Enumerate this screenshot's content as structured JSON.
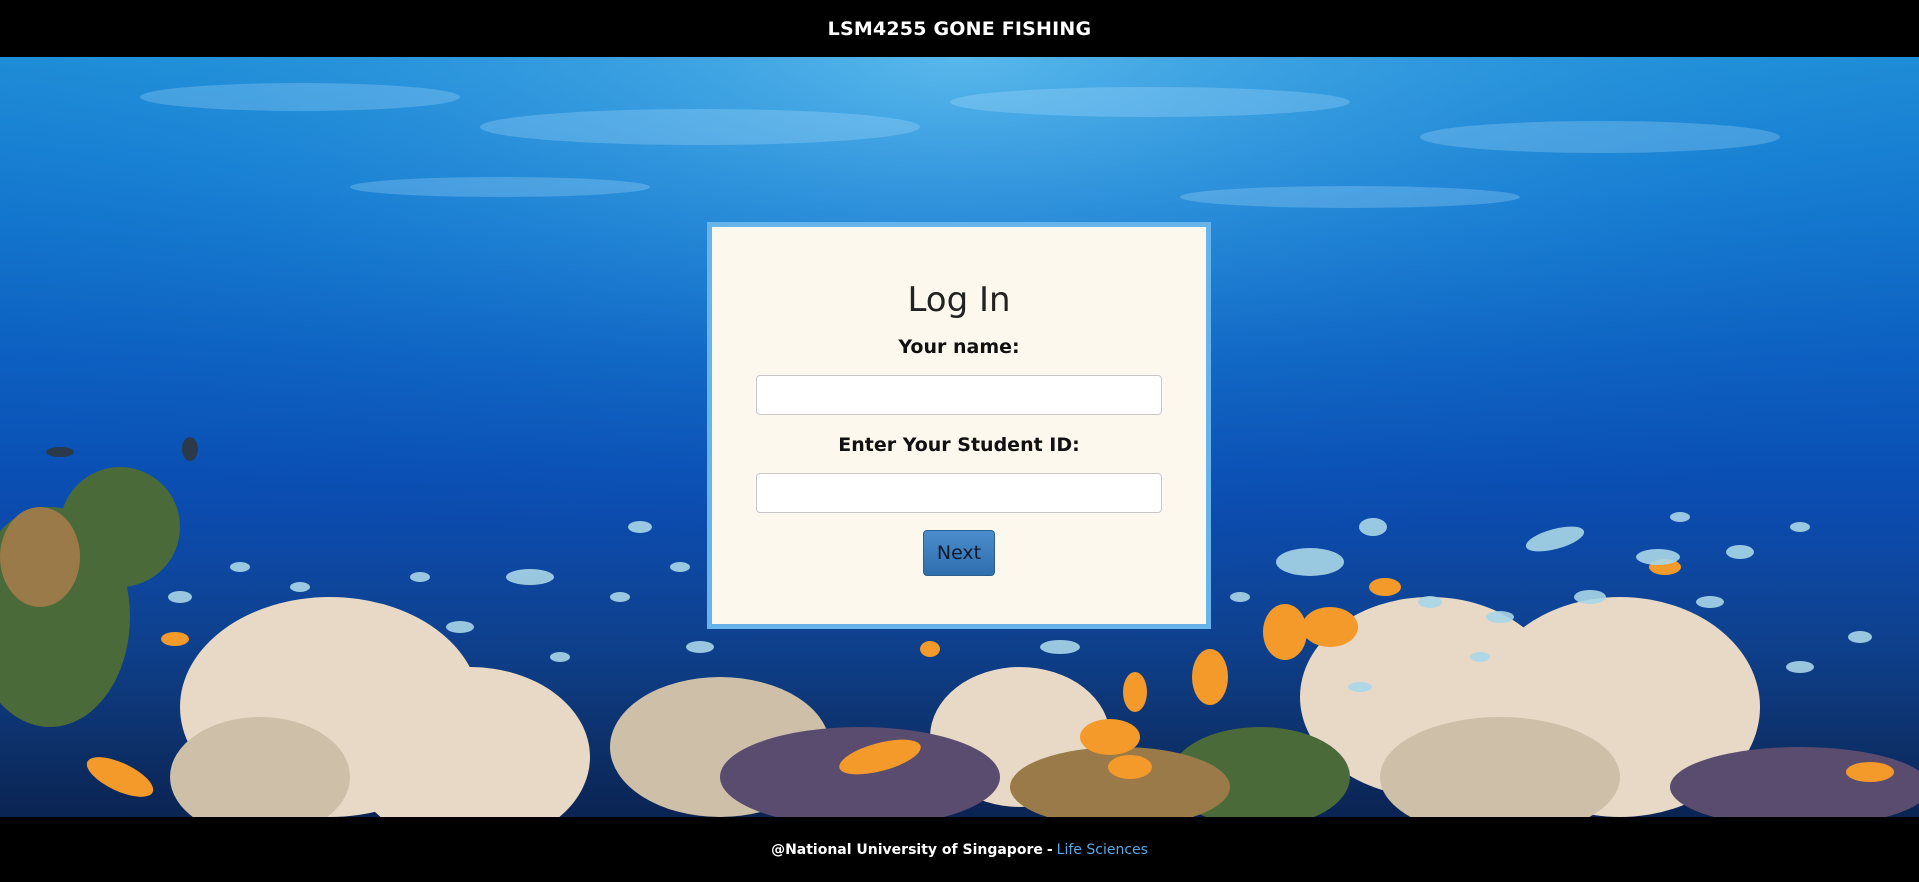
{
  "header": {
    "title": "LSM4255 GONE FISHING"
  },
  "login": {
    "heading": "Log In",
    "name_label": "Your name:",
    "name_value": "",
    "student_id_label": "Enter Your Student ID:",
    "student_id_value": "",
    "next_label": "Next"
  },
  "footer": {
    "copyright": "@National University of Singapore",
    "separator": "-",
    "link_label": "Life Sciences"
  },
  "background": {
    "image": "underwater-coral-reef"
  },
  "colors": {
    "header_bg": "#000000",
    "card_bg": "#fdf8ee",
    "card_border": "#67b4ea",
    "button": "#3a7bbd",
    "link": "#5aa8e8"
  }
}
